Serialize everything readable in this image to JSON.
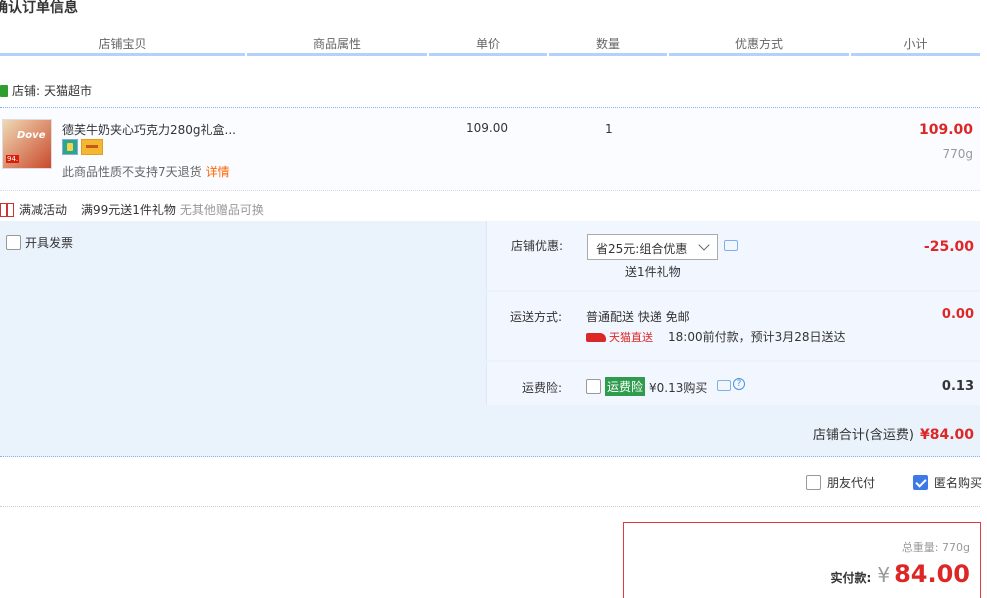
{
  "header": {
    "title": "确认订单信息"
  },
  "columns": [
    "店铺宝贝",
    "商品属性",
    "单价",
    "数量",
    "优惠方式",
    "小计"
  ],
  "shop": {
    "label": "店铺:",
    "name": "天猫超市"
  },
  "item": {
    "name": "德芙牛奶夹心巧克力280g礼盒...",
    "return_note": "此商品性质不支持7天退货",
    "details_link": "详情",
    "unit_price": "109.00",
    "quantity": "1",
    "subtotal": "109.00",
    "weight": "770g",
    "thumb_brand": "Dove",
    "thumb_price": "94."
  },
  "promotion": {
    "label": "满减活动",
    "detail": "满99元送1件礼物",
    "note": "无其他赠品可换"
  },
  "invoice": {
    "label": "开具发票"
  },
  "store_discount": {
    "label": "店铺优惠:",
    "selected": "省25元:组合优惠",
    "gift": "送1件礼物",
    "amount": "-25.00"
  },
  "shipping": {
    "label": "运送方式:",
    "method": "普通配送 快递 免邮",
    "carrier": "天猫直送",
    "eta": "18:00前付款，预计3月28日送达",
    "amount": "0.00"
  },
  "insurance": {
    "label": "运费险:",
    "tag": "运费险",
    "price": "¥0.13购买",
    "amount": "0.13",
    "help": "?"
  },
  "shop_total": {
    "label": "店铺合计(含运费)",
    "amount": "¥84.00"
  },
  "options": {
    "friend_pay": "朋友代付",
    "anonymous": "匿名购买"
  },
  "summary": {
    "total_weight": "总重量: 770g",
    "paid_label": "实付款:",
    "currency": "¥",
    "paid_amount": "84.00"
  },
  "colors": {
    "accent": "#dd2727",
    "header_border": "#b2d1ff",
    "panel_bg": "#eaf2fb"
  }
}
